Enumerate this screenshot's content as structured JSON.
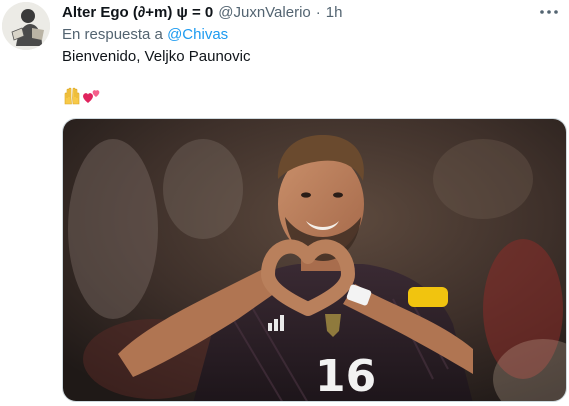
{
  "tweet": {
    "display_name": "Alter Ego (∂+m) ψ = 0",
    "handle": "@JuxnValerio",
    "separator": "·",
    "timestamp": "1h",
    "reply_prefix": "En respuesta a",
    "reply_mention": "@Chivas",
    "text": "Bienvenido, Veljko Paunovic",
    "emojis": [
      "raising-hands-icon",
      "two-hearts-icon"
    ],
    "more_icon": "more-horizontal-icon",
    "jersey_number": "16",
    "accent_color": "#1d9bf0",
    "muted_color": "#536471"
  }
}
